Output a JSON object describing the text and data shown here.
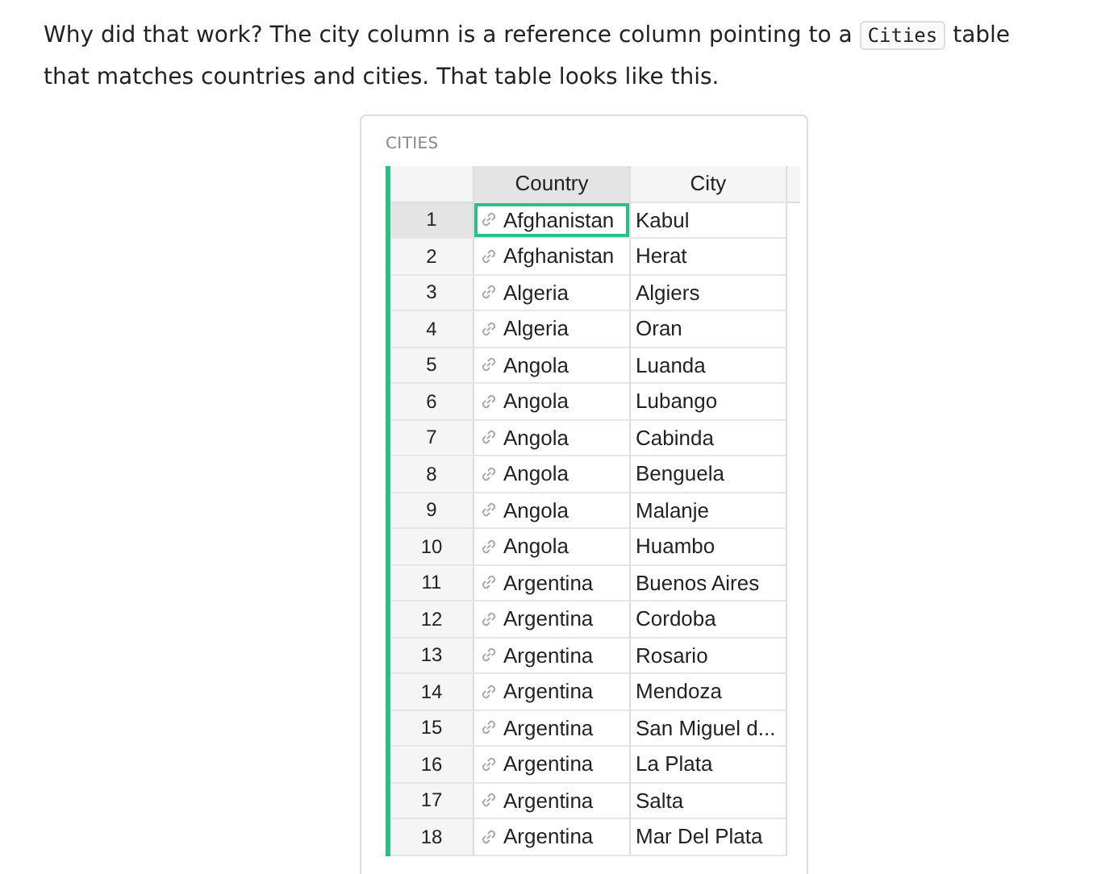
{
  "intro": {
    "before": "Why did that work? The city column is a reference column pointing to a",
    "code": "Cities",
    "after": "table that matches countries and cities. That table looks like this."
  },
  "table": {
    "title": "CITIES",
    "columns": [
      {
        "label": "Country",
        "selected": true
      },
      {
        "label": "City",
        "selected": false
      }
    ],
    "rows": [
      {
        "number": "1",
        "country": "Afghanistan",
        "city": "Kabul",
        "selected": true
      },
      {
        "number": "2",
        "country": "Afghanistan",
        "city": "Herat",
        "selected": false
      },
      {
        "number": "3",
        "country": "Algeria",
        "city": "Algiers",
        "selected": false
      },
      {
        "number": "4",
        "country": "Algeria",
        "city": "Oran",
        "selected": false
      },
      {
        "number": "5",
        "country": "Angola",
        "city": "Luanda",
        "selected": false
      },
      {
        "number": "6",
        "country": "Angola",
        "city": "Lubango",
        "selected": false
      },
      {
        "number": "7",
        "country": "Angola",
        "city": "Cabinda",
        "selected": false
      },
      {
        "number": "8",
        "country": "Angola",
        "city": "Benguela",
        "selected": false
      },
      {
        "number": "9",
        "country": "Angola",
        "city": "Malanje",
        "selected": false
      },
      {
        "number": "10",
        "country": "Angola",
        "city": "Huambo",
        "selected": false
      },
      {
        "number": "11",
        "country": "Argentina",
        "city": "Buenos Aires",
        "selected": false
      },
      {
        "number": "12",
        "country": "Argentina",
        "city": "Cordoba",
        "selected": false
      },
      {
        "number": "13",
        "country": "Argentina",
        "city": "Rosario",
        "selected": false
      },
      {
        "number": "14",
        "country": "Argentina",
        "city": "Mendoza",
        "selected": false
      },
      {
        "number": "15",
        "country": "Argentina",
        "city": "San Miguel d...",
        "selected": false
      },
      {
        "number": "16",
        "country": "Argentina",
        "city": "La Plata",
        "selected": false
      },
      {
        "number": "17",
        "country": "Argentina",
        "city": "Salta",
        "selected": false
      },
      {
        "number": "18",
        "country": "Argentina",
        "city": "Mar Del Plata",
        "selected": false
      }
    ]
  }
}
